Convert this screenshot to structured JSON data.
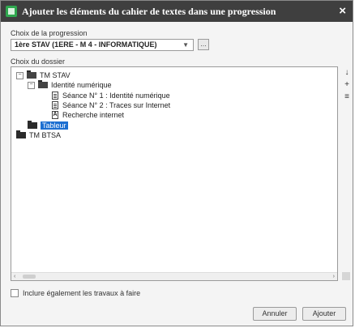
{
  "dialog": {
    "title": "Ajouter les éléments du cahier de textes dans une progression",
    "close_glyph": "×"
  },
  "progression": {
    "label": "Choix de la progression",
    "selected": "1ère STAV (1ERE - M 4 - INFORMATIQUE)",
    "caret": "▼",
    "extra_button": "..."
  },
  "dossier": {
    "label": "Choix du dossier",
    "tree": [
      {
        "toggle": "−",
        "label": "TM STAV",
        "icon": "folder-icon"
      },
      {
        "toggle": "−",
        "label": "Identité numérique",
        "icon": "folder-icon"
      },
      {
        "label": "Séance N° 1 : Identité numérique",
        "icon": "document-icon"
      },
      {
        "label": "Séance N° 2 : Traces sur Internet",
        "icon": "document-icon"
      },
      {
        "label": "Recherche internet",
        "icon": "link-icon",
        "badge": "A"
      },
      {
        "label": "Tableur",
        "icon": "folder-icon",
        "selected": true
      },
      {
        "label": "TM BTSA",
        "icon": "folder-icon"
      }
    ],
    "tools": [
      "↓",
      "+",
      "≡"
    ]
  },
  "scroll": {
    "left": "‹",
    "right": "›"
  },
  "options": {
    "include_label": "Inclure également les travaux à faire"
  },
  "buttons": {
    "cancel": "Annuler",
    "add": "Ajouter"
  }
}
